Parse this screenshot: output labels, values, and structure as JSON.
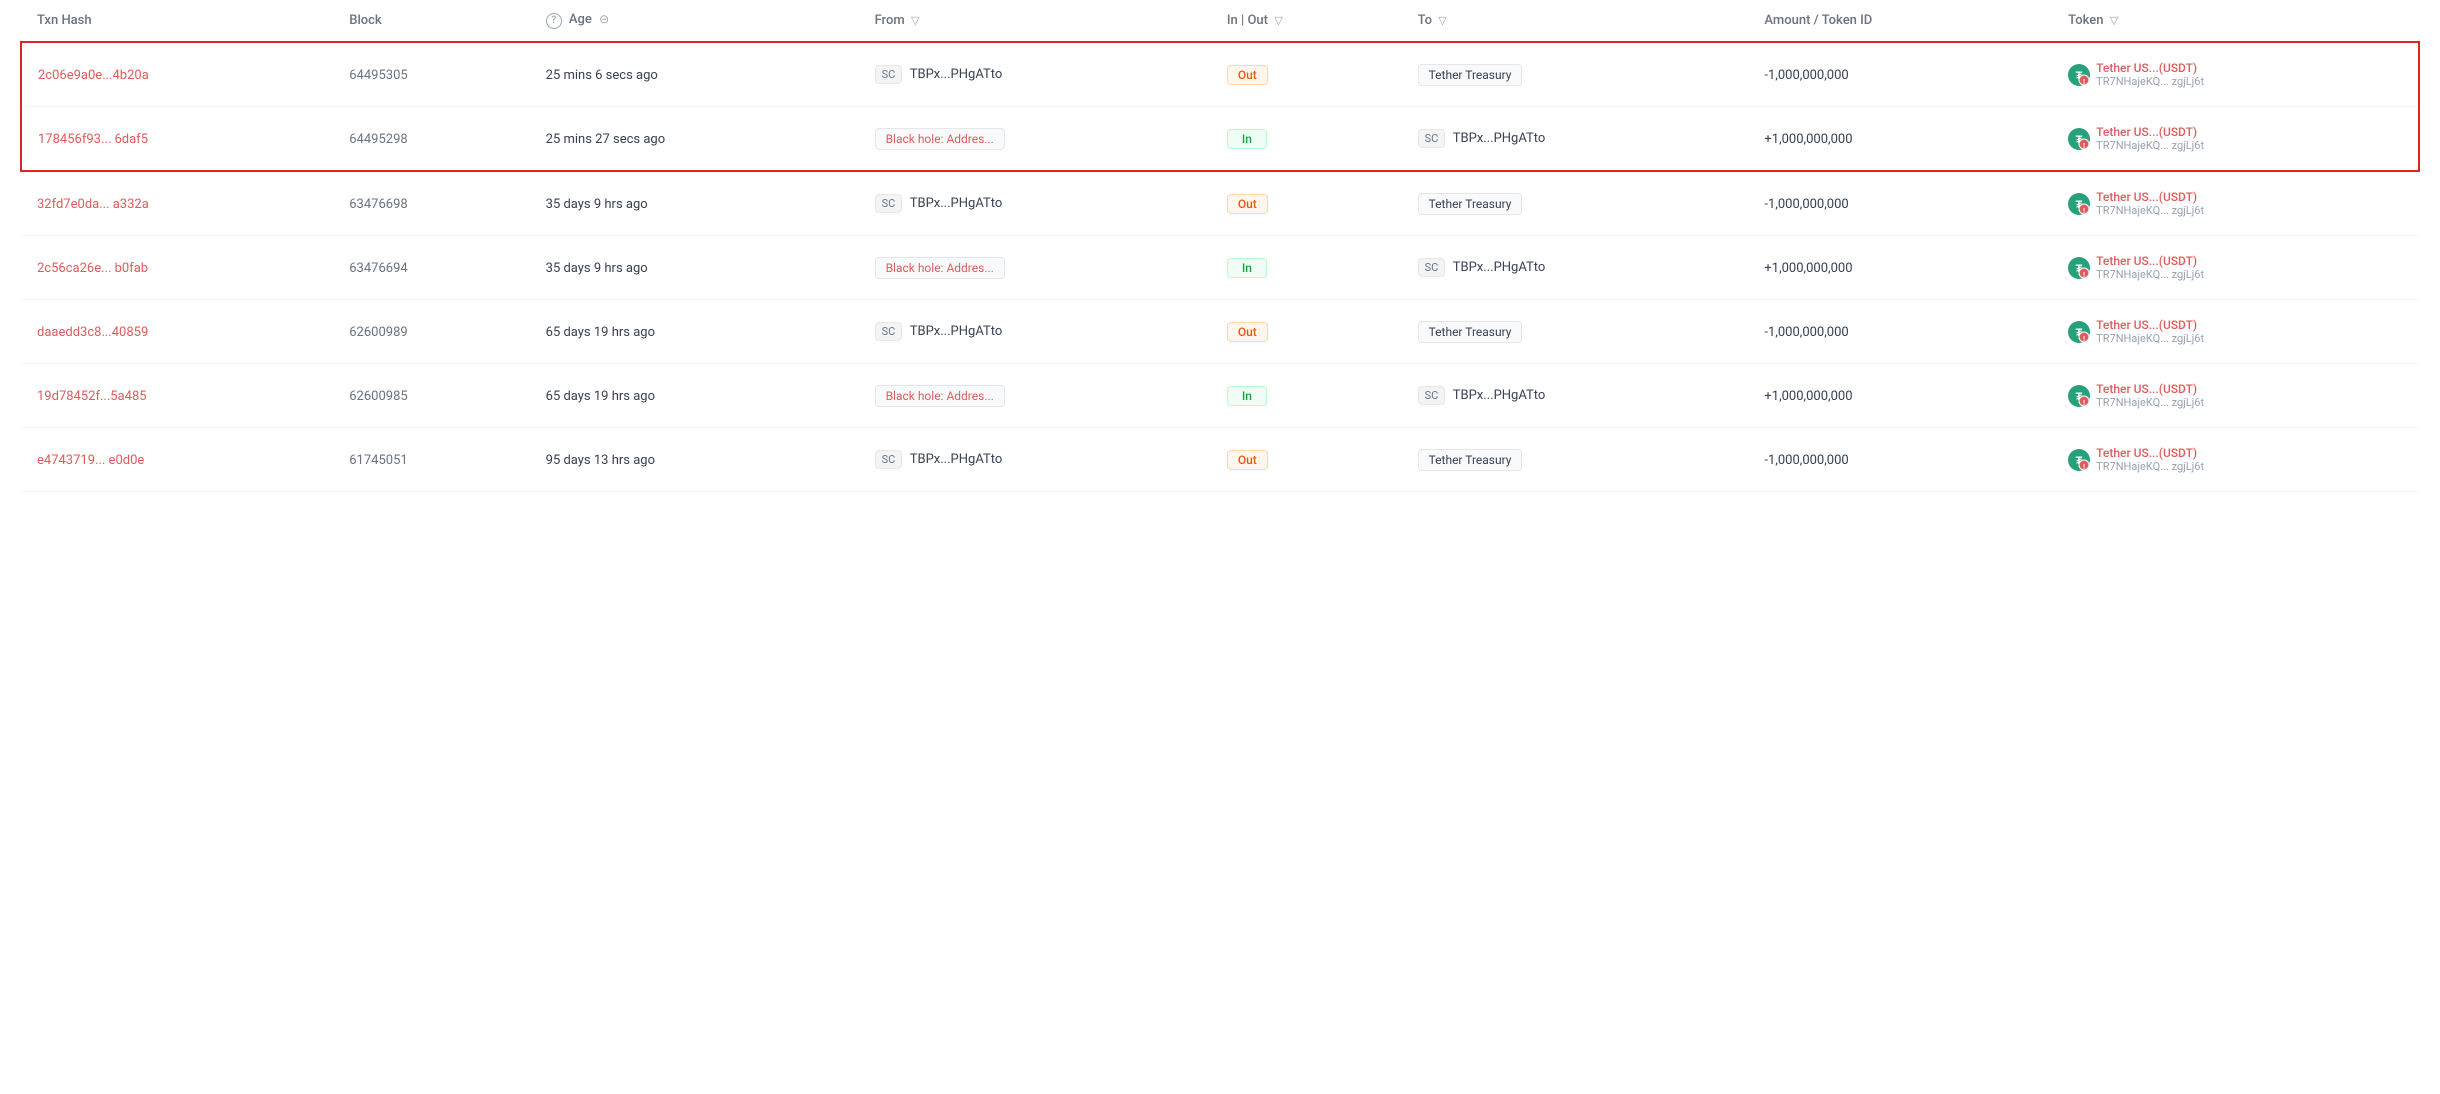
{
  "columns": [
    {
      "key": "txn_hash",
      "label": "Txn Hash",
      "hasFilter": false,
      "hasQuestion": false
    },
    {
      "key": "block",
      "label": "Block",
      "hasFilter": false,
      "hasQuestion": false
    },
    {
      "key": "age",
      "label": "Age",
      "hasFilter": false,
      "hasQuestion": true,
      "hasCircle": true
    },
    {
      "key": "from",
      "label": "From",
      "hasFilter": true,
      "hasQuestion": false
    },
    {
      "key": "inout",
      "label": "In | Out",
      "hasFilter": true,
      "hasQuestion": false
    },
    {
      "key": "to",
      "label": "To",
      "hasFilter": true,
      "hasQuestion": false
    },
    {
      "key": "amount",
      "label": "Amount / Token ID",
      "hasFilter": false,
      "hasQuestion": false
    },
    {
      "key": "token",
      "label": "Token",
      "hasFilter": true,
      "hasQuestion": false
    }
  ],
  "rows": [
    {
      "id": "row1",
      "highlighted": true,
      "highlightTop": true,
      "txnHash": "2c06e9a0e...4b20a",
      "block": "64495305",
      "age": "25 mins 6 secs ago",
      "fromSC": true,
      "fromAddress": "TBPx...PHgATto",
      "direction": "Out",
      "toSC": false,
      "toAddress": "Tether Treasury",
      "toIsAddress": false,
      "toIsBlackHole": false,
      "amount": "-1,000,000,000",
      "amountPositive": false,
      "tokenName": "Tether US...(USDT)",
      "tokenAddr": "TR7NHajeKQ... zgjLj6t"
    },
    {
      "id": "row2",
      "highlighted": true,
      "highlightBottom": true,
      "txnHash": "178456f93... 6daf5",
      "block": "64495298",
      "age": "25 mins 27 secs ago",
      "fromSC": false,
      "fromAddress": "Black hole: Addres...",
      "fromIsBlackHole": true,
      "direction": "In",
      "toSC": true,
      "toAddress": "TBPx...PHgATto",
      "toIsAddress": true,
      "toIsBlackHole": false,
      "amount": "+1,000,000,000",
      "amountPositive": true,
      "tokenName": "Tether US...(USDT)",
      "tokenAddr": "TR7NHajeKQ... zgjLj6t"
    },
    {
      "id": "row3",
      "highlighted": false,
      "txnHash": "32fd7e0da... a332a",
      "block": "63476698",
      "age": "35 days 9 hrs ago",
      "fromSC": true,
      "fromAddress": "TBPx...PHgATto",
      "direction": "Out",
      "toSC": false,
      "toAddress": "Tether Treasury",
      "toIsAddress": false,
      "toIsBlackHole": false,
      "amount": "-1,000,000,000",
      "amountPositive": false,
      "tokenName": "Tether US...(USDT)",
      "tokenAddr": "TR7NHajeKQ... zgjLj6t"
    },
    {
      "id": "row4",
      "highlighted": false,
      "txnHash": "2c56ca26e... b0fab",
      "block": "63476694",
      "age": "35 days 9 hrs ago",
      "fromSC": false,
      "fromAddress": "Black hole: Addres...",
      "fromIsBlackHole": true,
      "direction": "In",
      "toSC": true,
      "toAddress": "TBPx...PHgATto",
      "toIsAddress": true,
      "toIsBlackHole": false,
      "amount": "+1,000,000,000",
      "amountPositive": true,
      "tokenName": "Tether US...(USDT)",
      "tokenAddr": "TR7NHajeKQ... zgjLj6t"
    },
    {
      "id": "row5",
      "highlighted": false,
      "txnHash": "daaedd3c8...40859",
      "block": "62600989",
      "age": "65 days 19 hrs ago",
      "fromSC": true,
      "fromAddress": "TBPx...PHgATto",
      "direction": "Out",
      "toSC": false,
      "toAddress": "Tether Treasury",
      "toIsAddress": false,
      "toIsBlackHole": false,
      "amount": "-1,000,000,000",
      "amountPositive": false,
      "tokenName": "Tether US...(USDT)",
      "tokenAddr": "TR7NHajeKQ... zgjLj6t"
    },
    {
      "id": "row6",
      "highlighted": false,
      "txnHash": "19d78452f...5a485",
      "block": "62600985",
      "age": "65 days 19 hrs ago",
      "fromSC": false,
      "fromAddress": "Black hole: Addres...",
      "fromIsBlackHole": true,
      "direction": "In",
      "toSC": true,
      "toAddress": "TBPx...PHgATto",
      "toIsAddress": true,
      "toIsBlackHole": false,
      "amount": "+1,000,000,000",
      "amountPositive": true,
      "tokenName": "Tether US...(USDT)",
      "tokenAddr": "TR7NHajeKQ... zgjLj6t"
    },
    {
      "id": "row7",
      "highlighted": false,
      "txnHash": "e4743719... e0d0e",
      "block": "61745051",
      "age": "95 days 13 hrs ago",
      "fromSC": true,
      "fromAddress": "TBPx...PHgATto",
      "direction": "Out",
      "toSC": false,
      "toAddress": "Tether Treasury",
      "toIsAddress": false,
      "toIsBlackHole": false,
      "amount": "-1,000,000,000",
      "amountPositive": false,
      "tokenName": "Tether US...(USDT)",
      "tokenAddr": "TR7NHajeKQ... zgjLj6t"
    }
  ],
  "labels": {
    "out": "Out",
    "in": "In",
    "sc": "SC",
    "filterIcon": "▽",
    "questionMark": "?",
    "circleIcon": "⊝"
  }
}
